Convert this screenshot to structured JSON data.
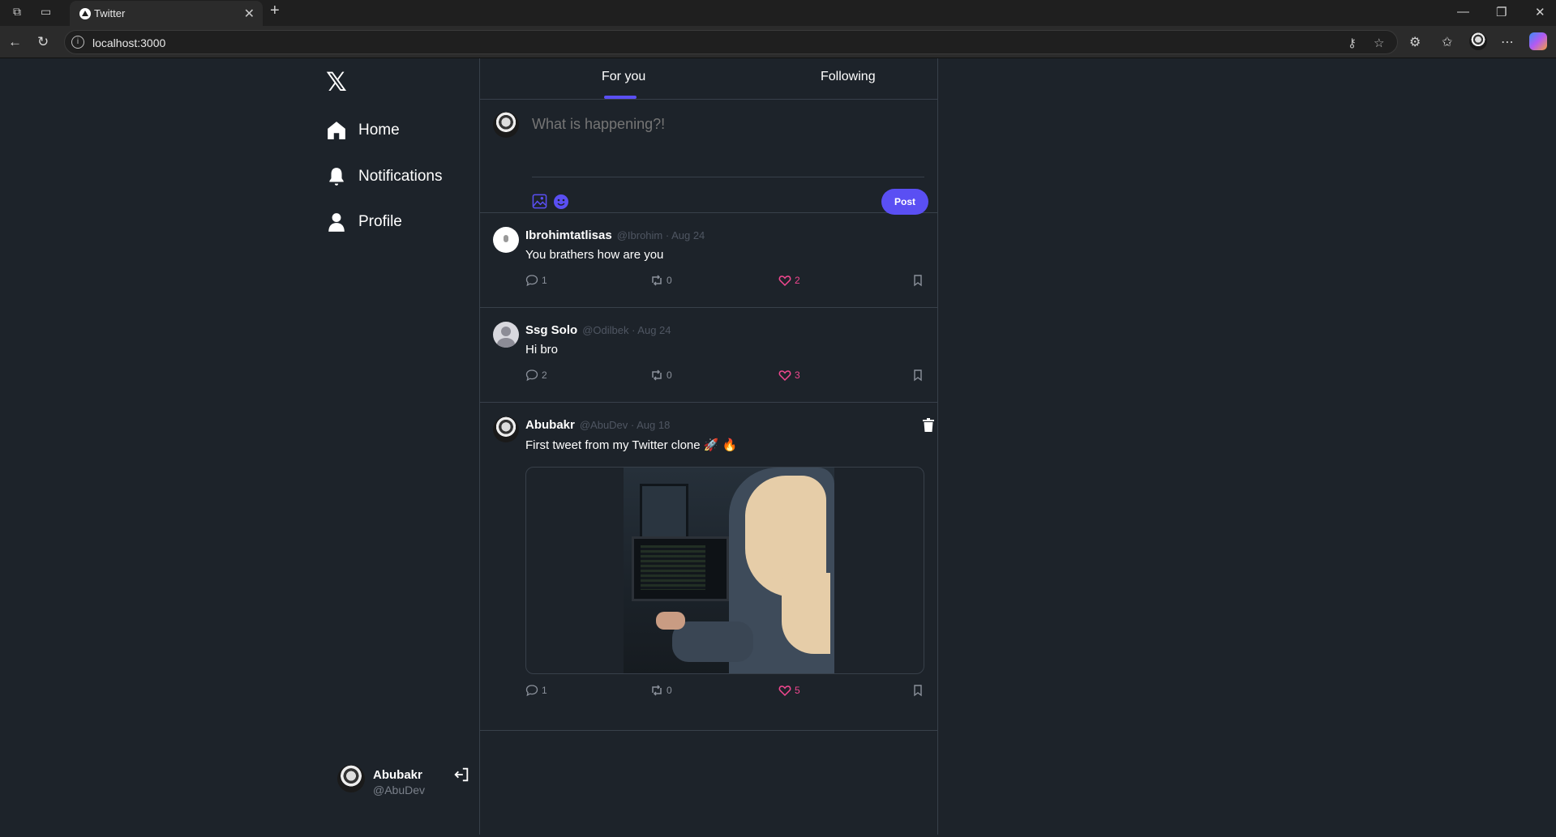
{
  "browser": {
    "tab_title": "Twitter",
    "tab_close": "✕",
    "new_tab": "+",
    "url": "localhost:3000"
  },
  "sidebar": {
    "logo": "𝕏",
    "items": [
      {
        "label": "Home",
        "icon": "home-icon"
      },
      {
        "label": "Notifications",
        "icon": "bell-icon"
      },
      {
        "label": "Profile",
        "icon": "person-icon"
      }
    ],
    "user": {
      "name": "Abubakr",
      "handle": "@AbuDev"
    }
  },
  "feed": {
    "tabs": [
      {
        "label": "For you",
        "active": true
      },
      {
        "label": "Following",
        "active": false
      }
    ],
    "composer": {
      "placeholder": "What is happening?!",
      "post_label": "Post"
    },
    "tweets": [
      {
        "name": "Ibrohimtatlisas",
        "meta": "@Ibrohim · Aug 24",
        "text": "You brathers how are you",
        "replies": "1",
        "retweets": "0",
        "likes": "2"
      },
      {
        "name": "Ssg Solo",
        "meta": "@Odilbek · Aug 24",
        "text": "Hi bro",
        "replies": "2",
        "retweets": "0",
        "likes": "3"
      },
      {
        "name": "Abubakr",
        "meta": "@AbuDev · Aug 18",
        "text": "First tweet from my Twitter clone 🚀 🔥",
        "replies": "1",
        "retweets": "0",
        "likes": "5",
        "has_image": true,
        "deletable": true
      }
    ]
  },
  "colors": {
    "accent": "#5a4ff3",
    "like": "#f0478f",
    "background": "#1d232a",
    "border": "#38404a"
  }
}
